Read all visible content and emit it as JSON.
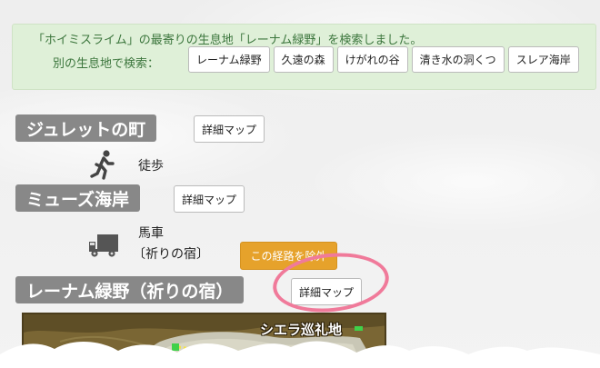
{
  "notice": {
    "message": "「ホイミスライム」の最寄りの生息地「レーナム緑野」を検索しました。",
    "alt_label": "別の生息地で検索：",
    "alternatives": [
      "レーナム緑野",
      "久遠の森",
      "けがれの谷",
      "清き水の洞くつ",
      "スレア海岸"
    ]
  },
  "route": {
    "stops": [
      {
        "name": "ジュレットの町",
        "map_button": "詳細マップ"
      },
      {
        "name": "ミューズ海岸",
        "map_button": "詳細マップ"
      },
      {
        "name": "レーナム緑野（祈りの宿）",
        "map_button": "詳細マップ"
      }
    ],
    "segments": [
      {
        "mode": "徒歩",
        "icon": "walking-person-icon"
      },
      {
        "mode": "馬車",
        "via": "〔祈りの宿〕",
        "icon": "truck-icon",
        "exclude_button": "この経路を除外"
      }
    ]
  },
  "map_preview": {
    "place_label": "シエラ巡礼地"
  },
  "colors": {
    "notice_bg": "#dff0d8",
    "notice_text": "#3c763d",
    "heading_bg": "#888888",
    "exclude_button": "#e6a22b",
    "annotation_circle": "#f07a9a"
  }
}
